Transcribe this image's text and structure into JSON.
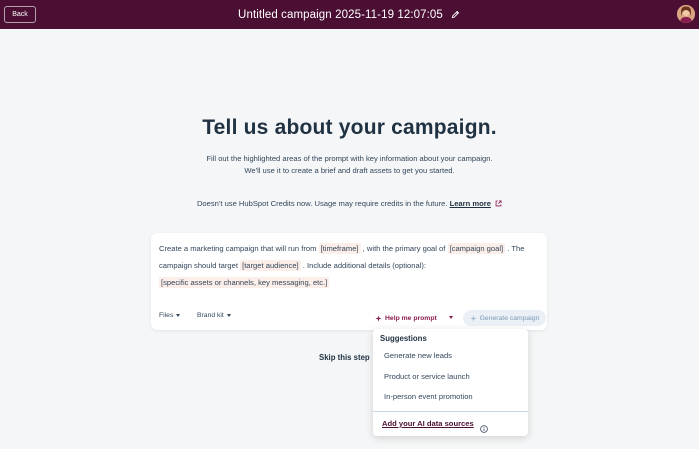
{
  "header": {
    "back_label": "Back",
    "title": "Untitled campaign 2025-11-19 12:07:05",
    "edit_icon": "pencil-icon",
    "avatar_icon": "user-avatar"
  },
  "hero": {
    "title": "Tell us about your campaign.",
    "subtitle_line1": "Fill out the highlighted areas of the prompt with key information about your campaign.",
    "subtitle_line2": "We'll use it to create a brief and draft assets to get you started."
  },
  "credits": {
    "text": "Doesn't use HubSpot Credits now. Usage may require credits in the future.",
    "link": "Learn more"
  },
  "prompt": {
    "part1": "Create a marketing campaign that will run from",
    "token_timeframe": "[timeframe]",
    "part2": ", with the primary goal of",
    "token_goal": "[campaign goal]",
    "part3": ". The campaign should target",
    "token_audience": "[target audience]",
    "part4": ". Include additional details (optional):",
    "token_details": "[specific assets or channels, key messaging, etc.]"
  },
  "toolbar": {
    "files_label": "Files",
    "brand_kit_label": "Brand kit",
    "help_label": "Help me prompt",
    "generate_label": "Generate campaign"
  },
  "skip_label": "Skip this step",
  "dropdown": {
    "heading": "Suggestions",
    "items": [
      "Generate new leads",
      "Product or service launch",
      "In-person event promotion"
    ],
    "link": "Add your AI data sources"
  },
  "colors": {
    "header_bg": "#4a0f32",
    "token_bg": "#fceee8",
    "accent": "#8a1c4f"
  }
}
